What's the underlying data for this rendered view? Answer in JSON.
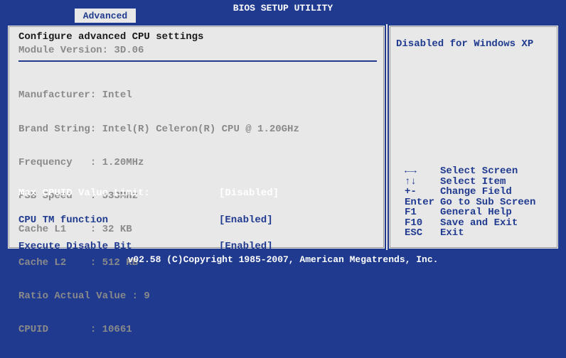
{
  "header": {
    "title": "BIOS SETUP UTILITY",
    "active_tab": "Advanced"
  },
  "main": {
    "heading": "Configure advanced CPU settings",
    "module_version": "Module Version: 3D.06",
    "info_lines": [
      "Manufacturer: Intel",
      "Brand String: Intel(R) Celeron(R) CPU @ 1.20GHz",
      "Frequency   : 1.20MHz",
      "FSB Speed   : 533MHz",
      "Cache L1    : 32 KB",
      "Cache L2    : 512 KB",
      "Ratio Actual Value : 9",
      "CPUID       : 10661"
    ],
    "options": [
      {
        "name": "Max CPUID Value Limit:",
        "value": "[Disabled]"
      },
      {
        "name": "CPU TM function",
        "value": "[Enabled]"
      },
      {
        "name": "Execute Disable Bit",
        "value": "[Enabled]"
      }
    ]
  },
  "help": {
    "text": "Disabled for Windows XP",
    "keys": [
      {
        "key": "←→",
        "desc": "Select Screen"
      },
      {
        "key": "↑↓",
        "desc": "Select Item"
      },
      {
        "key": "+-",
        "desc": "Change Field"
      },
      {
        "key": "Enter",
        "desc": "Go to Sub Screen"
      },
      {
        "key": "F1",
        "desc": "General Help"
      },
      {
        "key": "F10",
        "desc": "Save and Exit"
      },
      {
        "key": "ESC",
        "desc": "Exit"
      }
    ]
  },
  "footer": {
    "text": "v02.58 (C)Copyright 1985-2007, American Megatrends, Inc."
  },
  "colors": {
    "bios_blue": "#1f3a8f",
    "panel_gray": "#e8e8e8",
    "text_gray": "#8a8a8a"
  }
}
